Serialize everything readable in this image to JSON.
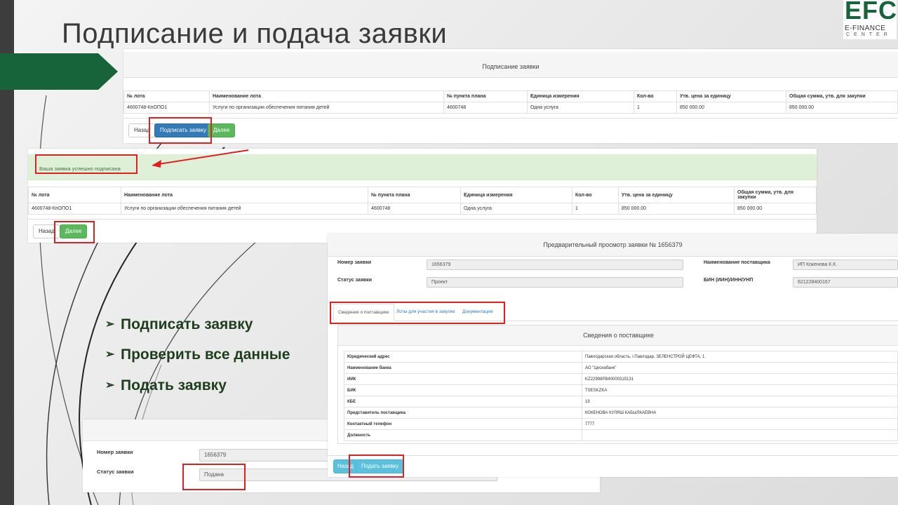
{
  "slide": {
    "title": "Подписание и подача заявки",
    "logo": {
      "main": "EFC",
      "sub": "E-FINANCE",
      "sub2": "CENTER"
    }
  },
  "sign_panel": {
    "header": "Подписание заявки",
    "columns": [
      "№ лота",
      "Наименование лота",
      "№ пункта плана",
      "Единица измерения",
      "Кол-во",
      "Утв. цена за единицу",
      "Общая сумма, утв. для закупки"
    ],
    "row": [
      "4600748-КпОПО1",
      "Услуги по организации обеспечения питания детей",
      "4600748",
      "Одна услуга",
      "1",
      "850 000.00",
      "850 000.00"
    ],
    "buttons": {
      "back": "Назад",
      "sign": "Подписать заявку",
      "next": "Далее"
    }
  },
  "success_panel": {
    "message": "Ваша заявка успешно подписана",
    "columns": [
      "№ лота",
      "Наименование лота",
      "№ пункта плана",
      "Единица измерения",
      "Кол-во",
      "Утв. цена за единицу",
      "Общая сумма, утв. для закупки"
    ],
    "row": [
      "4600748-КпОПО1",
      "Услуги по организации обеспечения питания детей",
      "4600748",
      "Одна услуга",
      "1",
      "850 000.00",
      "850 000.00"
    ],
    "buttons": {
      "back": "Назад",
      "next": "Далее"
    }
  },
  "status_panel": {
    "number_label": "Номер заявки",
    "number_value": "1656379",
    "status_label": "Статус заявки",
    "status_value": "Подана"
  },
  "preview_panel": {
    "header": "Предварительный просмотр заявки № 1656379",
    "number_label": "Номер заявки",
    "number_value": "1656379",
    "status_label": "Статус заявки",
    "status_value": "Проект",
    "supplier_label": "Наименование поставщика",
    "supplier_value": "ИП Кокенова К.К.",
    "bin_label": "БИН (ИИН)/ИНН/УНП",
    "bin_value": "621228400167",
    "tabs": [
      "Сведения о поставщике",
      "Лоты для участия в закупке",
      "Документация"
    ],
    "supplier_box_title": "Сведения о поставщике",
    "supplier_rows": [
      {
        "k": "Юридический адрес",
        "v": "Павлодарская область, г.Павлодар, ЗЕЛЕНСТРОЙ ЦЕФТА, 1"
      },
      {
        "k": "Наименование банка",
        "v": "АО \"Цеснабанк\""
      },
      {
        "k": "ИИК",
        "v": "KZ22998PB40000315131"
      },
      {
        "k": "БИК",
        "v": "TSESKZKA"
      },
      {
        "k": "КБЕ",
        "v": "19"
      },
      {
        "k": "Представитель поставщика",
        "v": "КОКЕНОВА КУЛЯШ КАБЫЛКАЕВНА"
      },
      {
        "k": "Контактный телефон",
        "v": "7777"
      },
      {
        "k": "Должность",
        "v": ""
      }
    ],
    "buttons": {
      "back": "Назад",
      "submit": "Подать заявку"
    }
  },
  "bullets": [
    "Подписать заявку",
    "Проверить все данные",
    "Подать заявку"
  ],
  "colors": {
    "accent_green": "#17643a",
    "highlight_red": "#e02020"
  }
}
